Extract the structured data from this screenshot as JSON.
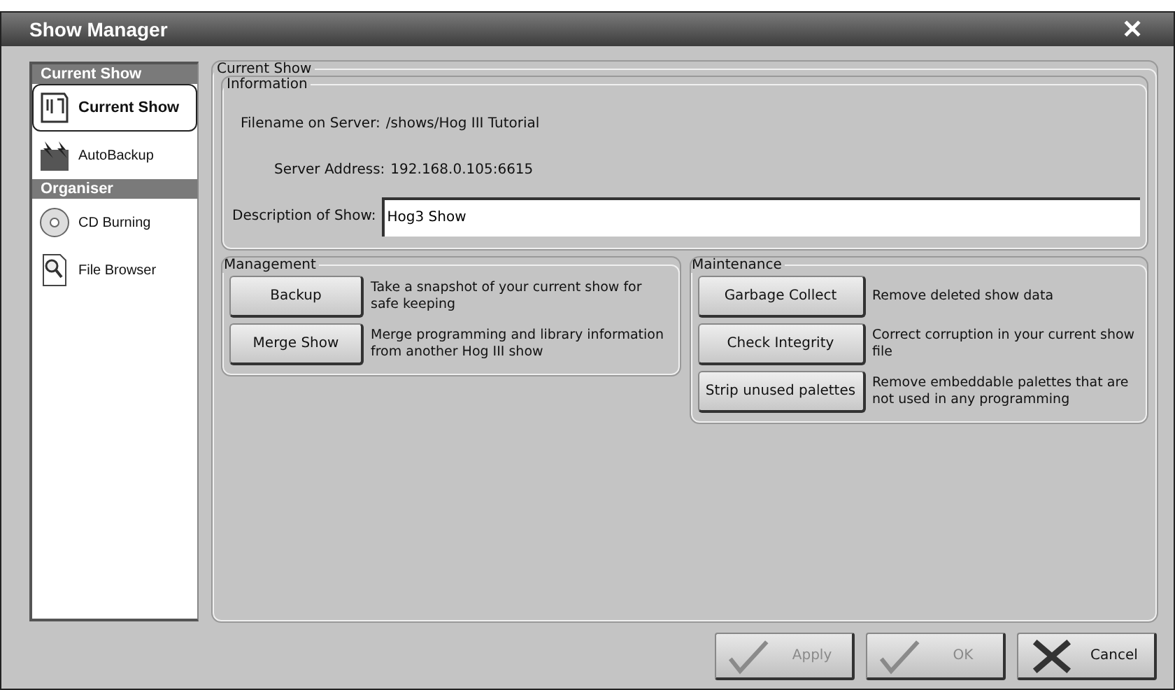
{
  "window": {
    "title": "Show Manager",
    "close": "✕"
  },
  "sidebar": [
    {
      "kind": "header",
      "label": "Current Show"
    },
    {
      "kind": "item",
      "label": "Current Show",
      "selected": true
    },
    {
      "kind": "item",
      "label": "AutoBackup",
      "selected": false
    },
    {
      "kind": "header",
      "label": "Organiser"
    },
    {
      "kind": "item",
      "label": "CD Burning",
      "selected": false
    },
    {
      "kind": "item",
      "label": "File Browser",
      "selected": false
    }
  ],
  "main": {
    "title": "Current Show",
    "information": {
      "title": "Information",
      "filename_label": "Filename on Server:",
      "filename": "/shows/Hog III Tutorial",
      "address_label": "Server Address:",
      "address": "192.168.0.105:6615",
      "description_label": "Description of Show:",
      "description": "Hog3 Show"
    },
    "management": {
      "title": "Management",
      "actions": [
        {
          "button": "Backup",
          "text": "Take a snapshot of your current show for safe keeping"
        },
        {
          "button": "Merge Show",
          "text": "Merge programming and library information from another Hog III show"
        }
      ]
    },
    "maintenance": {
      "title": "Maintenance",
      "actions": [
        {
          "button": "Garbage Collect",
          "text": "Remove deleted show data"
        },
        {
          "button": "Check Integrity",
          "text": "Correct corruption in your current show file"
        },
        {
          "button": "Strip unused palettes",
          "text": "Remove embeddable palettes that are not used in any programming"
        }
      ]
    }
  },
  "buttons": [
    {
      "label": "Apply",
      "disabled": true
    },
    {
      "label": "OK",
      "disabled": true
    },
    {
      "label": "Cancel",
      "disabled": false
    }
  ]
}
